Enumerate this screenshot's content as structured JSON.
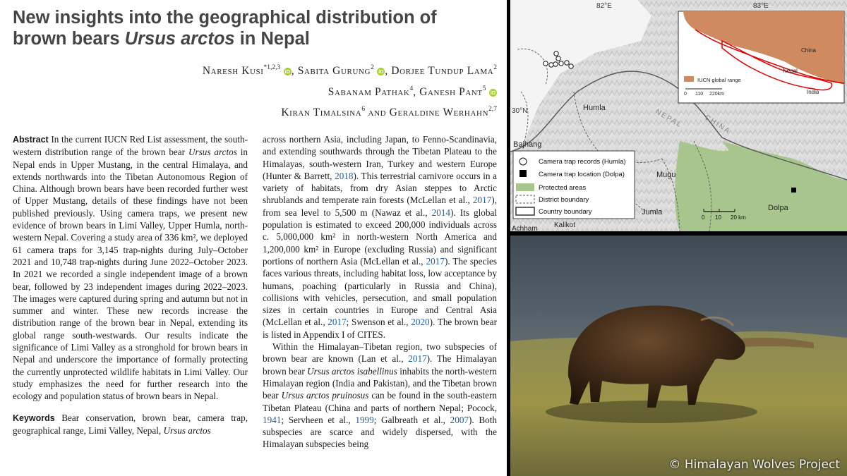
{
  "paper": {
    "title_line1": "New insights into the geographical distribution of",
    "title_line2_pre": "brown bears ",
    "title_line2_em": "Ursus arctos",
    "title_line2_post": " in Nepal",
    "authors": {
      "a1": "Naresh Kusi",
      "a1_sup": "*1,2,3",
      "a2": "Sabita Gurung",
      "a2_sup": "2",
      "a3": "Dorjee Tundup Lama",
      "a3_sup": "2",
      "a4": "Sabanam Pathak",
      "a4_sup": "4",
      "a5": "Ganesh Pant",
      "a5_sup": "5",
      "a6": "Kiran Timalsina",
      "a6_sup": "6",
      "a7": "Geraldine Werhahn",
      "a7_sup": "2,7",
      "sep_comma": ",",
      "sep_and": "and",
      "orcid": "iD"
    },
    "abstract": {
      "label": "Abstract",
      "t1": " In the current IUCN Red List assessment, the south-western distribution range of the brown bear ",
      "t1_em": "Ursus arctos",
      "t2": " in Nepal ends in Upper Mustang, in the central Himalaya, and extends northwards into the Tibetan Autonomous Region of China. Although brown bears have been recorded further west of Upper Mustang, details of these findings have not been published previously. Using camera traps, we present new evidence of brown bears in Limi Valley, Upper Humla, north-western Nepal. Covering a study area of 336 km², we deployed 61 camera traps for 3,145 trap-nights during July–October 2021 and 10,748 trap-nights during June 2022–October 2023. In 2021 we recorded a single independent image of a brown bear, followed by 23 independent images during 2022–2023. The images were captured during spring and autumn but not in summer and winter. These new records increase the distribution range of the brown bear in Nepal, extending its global range south-westwards. Our results indicate the significance of Limi Valley as a stronghold for brown bears in Nepal and underscore the importance of formally protecting the currently unprotected wildlife habitats in Limi Valley. Our study emphasizes the need for further research into the ecology and population status of brown bears in Nepal."
    },
    "keywords": {
      "label": "Keywords",
      "t1": " Bear conservation, brown bear, camera trap, geographical range, Limi Valley, Nepal, ",
      "t1_em": "Ursus arctos"
    },
    "right": {
      "p1a": "across northern Asia, including Japan, to Fenno-Scandinavia, and extending southwards through the Tibetan Plateau to the Himalayas, south-western Iran, Turkey and western Europe (Hunter & Barrett, ",
      "p1_ref1": "2018",
      "p1b": "). This terrestrial carnivore occurs in a variety of habitats, from dry Asian steppes to Arctic shrublands and temperate rain forests (McLellan et al., ",
      "p1_ref2": "2017",
      "p1c": "), from sea level to 5,500 m (Nawaz et al., ",
      "p1_ref3": "2014",
      "p1d": "). Its global population is estimated to exceed 200,000 individuals across c. 5,000,000 km² in north-western North America and 1,200,000 km² in Europe (excluding Russia) and significant portions of northern Asia (McLellan et al., ",
      "p1_ref4": "2017",
      "p1e": "). The species faces various threats, including habitat loss, low acceptance by humans, poaching (particularly in Russia and China), collisions with vehicles, persecution, and small population sizes in certain countries in Europe and Central Asia (McLellan et al., ",
      "p1_ref5": "2017",
      "p1f": "; Swenson et al., ",
      "p1_ref6": "2020",
      "p1g": "). The brown bear is listed in Appendix I of CITES.",
      "p2a": "Within the Himalayan–Tibetan region, two subspecies of brown bear are known (Lan et al., ",
      "p2_ref1": "2017",
      "p2b": "). The Himalayan brown bear ",
      "p2_em1": "Ursus arctos isabellinus",
      "p2c": " inhabits the north-western Himalayan region (India and Pakistan), and the Tibetan brown bear ",
      "p2_em2": "Ursus arctos pruinosus",
      "p2d": " can be found in the south-eastern Tibetan Plateau (China and parts of northern Nepal; Pocock, ",
      "p2_ref2": "1941",
      "p2e": "; Servheen et al., ",
      "p2_ref3": "1999",
      "p2f": "; Galbreath et al., ",
      "p2_ref4": "2007",
      "p2g": "). Both subspecies are scarce and widely dispersed, with the Himalayan subspecies being"
    }
  },
  "map": {
    "lon1": "82°E",
    "lon2": "83°E",
    "lat": "30°N",
    "labels": {
      "humla": "Humla",
      "bajhang": "Bajhang",
      "mugu": "Mugu",
      "jumla": "Jumla",
      "dolpa": "Dolpa",
      "achham": "Achham",
      "kalikot": "Kalikot",
      "nepal": "NEPAL",
      "china": "CHINA"
    },
    "inset": {
      "china": "China",
      "nepal": "Nepal",
      "india": "India",
      "legend_range": "IUCN global range",
      "scale_0": "0",
      "scale_110": "110",
      "scale_220": "220km"
    },
    "legend": {
      "humla": "Camera trap records (Humla)",
      "dolpa": "Camera trap location (Dolpa)",
      "protected": "Protected areas",
      "district": "District boundary",
      "country": "Country boundary"
    },
    "scale": {
      "s0": "0",
      "s10": "10",
      "s20": "20 km"
    },
    "colors": {
      "range": "#cf8a5f",
      "protected": "#a9c58e",
      "terrain": "#dadada"
    }
  },
  "photo": {
    "credit": "© Himalayan Wolves Project"
  }
}
